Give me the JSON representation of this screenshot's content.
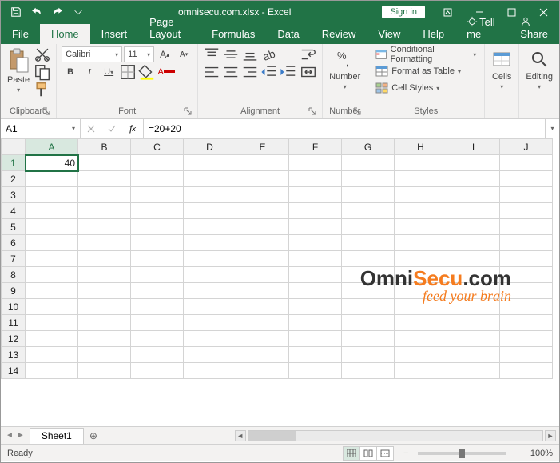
{
  "titlebar": {
    "title": "omnisecu.com.xlsx - Excel",
    "signin": "Sign in"
  },
  "tabs": {
    "file": "File",
    "home": "Home",
    "insert": "Insert",
    "pagelayout": "Page Layout",
    "formulas": "Formulas",
    "data": "Data",
    "review": "Review",
    "view": "View",
    "help": "Help",
    "tellme": "Tell me",
    "share": "Share"
  },
  "ribbon": {
    "clipboard": {
      "paste": "Paste",
      "label": "Clipboard"
    },
    "font": {
      "name": "Calibri",
      "size": "11",
      "label": "Font"
    },
    "alignment": {
      "label": "Alignment"
    },
    "number": {
      "btn": "Number",
      "label": "Number"
    },
    "styles": {
      "cond": "Conditional Formatting",
      "table": "Format as Table",
      "cell": "Cell Styles",
      "label": "Styles"
    },
    "cells": {
      "btn": "Cells"
    },
    "editing": {
      "btn": "Editing"
    }
  },
  "namebox": "A1",
  "formula": "=20+20",
  "columns": [
    "A",
    "B",
    "C",
    "D",
    "E",
    "F",
    "G",
    "H",
    "I",
    "J"
  ],
  "rows": [
    "1",
    "2",
    "3",
    "4",
    "5",
    "6",
    "7",
    "8",
    "9",
    "10",
    "11",
    "12",
    "13",
    "14"
  ],
  "cellA1": "40",
  "sheet": {
    "name": "Sheet1"
  },
  "status": {
    "ready": "Ready",
    "zoom": "100%"
  },
  "watermark": {
    "pre": "Omni",
    "mid": "Secu",
    "suf": ".com",
    "tag": "feed your brain"
  }
}
